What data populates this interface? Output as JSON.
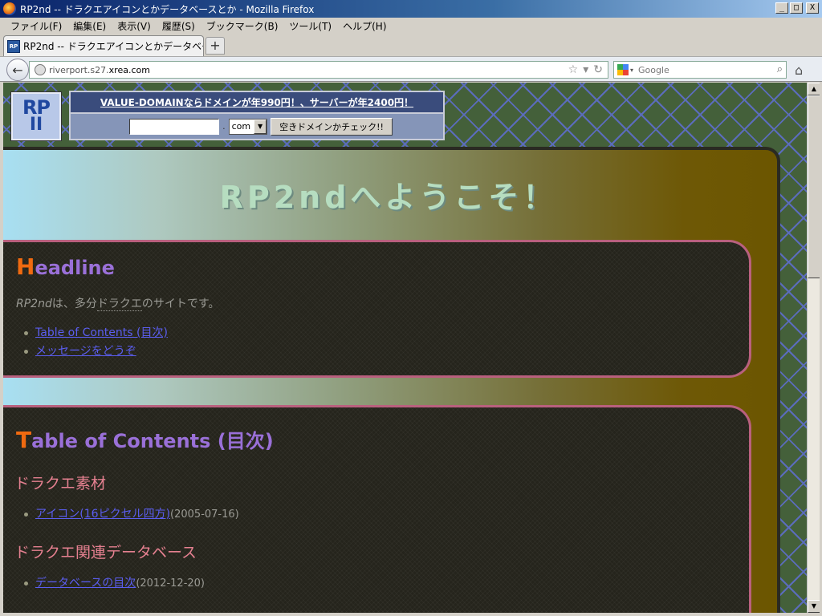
{
  "window": {
    "title": "RP2nd -- ドラクエアイコンとかデータベースとか - Mozilla Firefox",
    "buttons": {
      "minimize": "_",
      "maximize": "□",
      "close": "X"
    }
  },
  "menu": [
    "ファイル(F)",
    "編集(E)",
    "表示(V)",
    "履歴(S)",
    "ブックマーク(B)",
    "ツール(T)",
    "ヘルプ(H)"
  ],
  "tabs": [
    {
      "label": "RP2nd -- ドラクエアイコンとかデータベースとか",
      "icon": "RP"
    }
  ],
  "newtab_label": "+",
  "nav": {
    "url_plain": "riverport.s27.",
    "url_domain": "xrea.com",
    "search_placeholder": "Google"
  },
  "header": {
    "logo_line1": "RP",
    "logo_line2": "II",
    "ad_link": "VALUE-DOMAINならドメインが年990円！、サーバーが年2400円！",
    "domain_dot": ".",
    "tld_value": "com",
    "check_button": "空きドメインかチェック!!"
  },
  "welcome": "RP2ndへようこそ！",
  "headline": {
    "initial": "H",
    "rest": "eadline",
    "intro_rp": "RP2nd",
    "intro_mid": "は、多分",
    "intro_dq": "ドラクエ",
    "intro_end": "のサイトです。",
    "links": [
      "Table of Contents (目次)",
      "メッセージをどうぞ"
    ]
  },
  "toc": {
    "initial": "T",
    "rest": "able of Contents (目次)",
    "sections": [
      {
        "heading": "ドラクエ素材",
        "items": [
          {
            "link": "アイコン(16ピクセル四方)",
            "date": "(2005-07-16)"
          }
        ]
      },
      {
        "heading": "ドラクエ関連データベース",
        "items": [
          {
            "link": "データベースの目次",
            "date": "(2012-12-20)"
          }
        ]
      }
    ]
  },
  "colors": {
    "pattern_bg": "#44603a",
    "panel_bg": "#25241c",
    "panel_border": "#b9607e",
    "heading_purple": "#9a70d8",
    "initial_orange": "#f06a10",
    "link_blue": "#5b5ef0",
    "subheading_pink": "#e58090"
  }
}
